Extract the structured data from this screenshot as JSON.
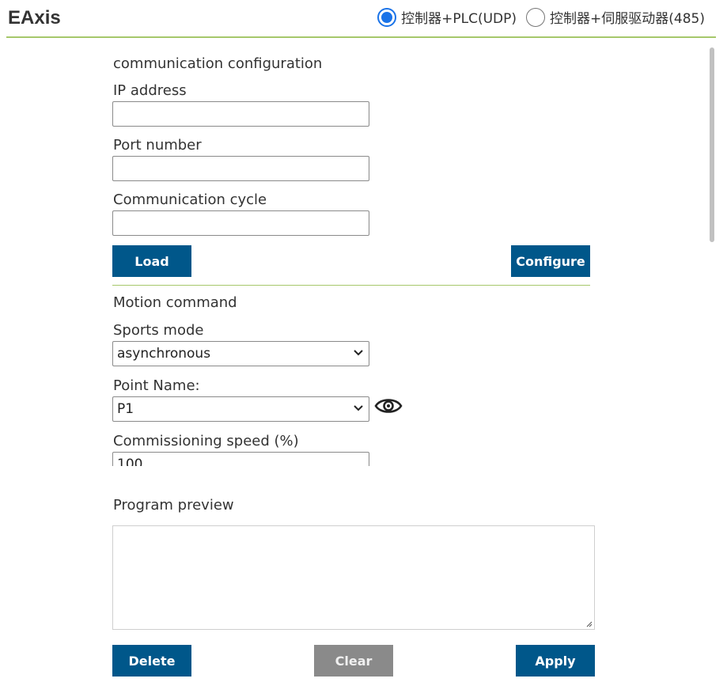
{
  "header": {
    "title": "EAxis",
    "modes": [
      {
        "label": "控制器+PLC(UDP)",
        "selected": true
      },
      {
        "label": "控制器+伺服驱动器(485)",
        "selected": false
      }
    ]
  },
  "communication": {
    "section_title": "communication configuration",
    "ip_label": "IP address",
    "ip_value": "",
    "port_label": "Port number",
    "port_value": "",
    "cycle_label": "Communication cycle",
    "cycle_value": "",
    "load_label": "Load",
    "configure_label": "Configure"
  },
  "motion": {
    "section_title": "Motion command",
    "sports_mode_label": "Sports mode",
    "sports_mode_value": "asynchronous",
    "point_name_label": "Point Name:",
    "point_name_value": "P1",
    "speed_label": "Commissioning speed (%)",
    "speed_value": "100"
  },
  "preview": {
    "label": "Program preview",
    "content": ""
  },
  "actions": {
    "delete_label": "Delete",
    "clear_label": "Clear",
    "apply_label": "Apply"
  },
  "colors": {
    "accent_line": "#a6c86b",
    "primary_button": "#00578a",
    "disabled_button": "#8a8a8a",
    "radio_selected": "#1a73e8"
  },
  "icons": {
    "view_point": "eye-icon",
    "dropdown": "chevron-down-icon"
  }
}
